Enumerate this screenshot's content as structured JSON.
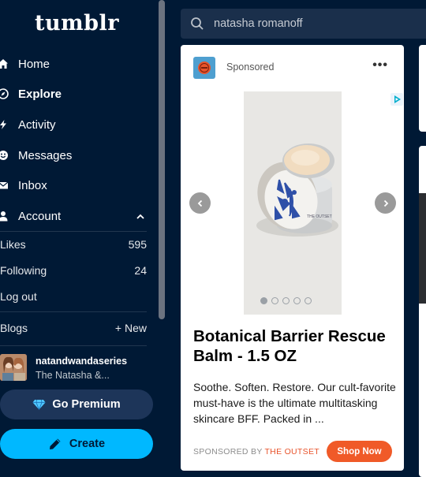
{
  "sidebar": {
    "logo": "tumblr",
    "nav": [
      {
        "label": "Home",
        "icon": "home-icon"
      },
      {
        "label": "Explore",
        "icon": "compass-icon",
        "active": true
      },
      {
        "label": "Activity",
        "icon": "lightning-icon"
      },
      {
        "label": "Messages",
        "icon": "smiley-icon"
      },
      {
        "label": "Inbox",
        "icon": "envelope-icon"
      },
      {
        "label": "Account",
        "icon": "person-icon",
        "expanded": true
      }
    ],
    "account": {
      "likes_label": "Likes",
      "likes_count": "595",
      "following_label": "Following",
      "following_count": "24",
      "logout_label": "Log out",
      "blogs_label": "Blogs",
      "new_label": "+ New"
    },
    "blog": {
      "name": "natandwandaseries",
      "title": "The Natasha &..."
    },
    "premium_label": "Go Premium",
    "create_label": "Create"
  },
  "search": {
    "query": "natasha romanoff"
  },
  "post": {
    "sponsored_label": "Sponsored",
    "headline": "Botanical Barrier Rescue Balm - 1.5 OZ",
    "description": "Soothe. Soften. Restore. Our cult-favorite must-have is the ultimate multitasking skincare BFF. Packed in ...",
    "sponsored_by_label": "SPONSORED BY",
    "brand": "THE OUTSET",
    "cta_label": "Shop Now",
    "product_label": "THE OUTSET",
    "carousel": {
      "total": 5,
      "current": 1
    }
  },
  "colors": {
    "background": "#001935",
    "accent": "#00b8ff",
    "cta": "#f05a28"
  }
}
